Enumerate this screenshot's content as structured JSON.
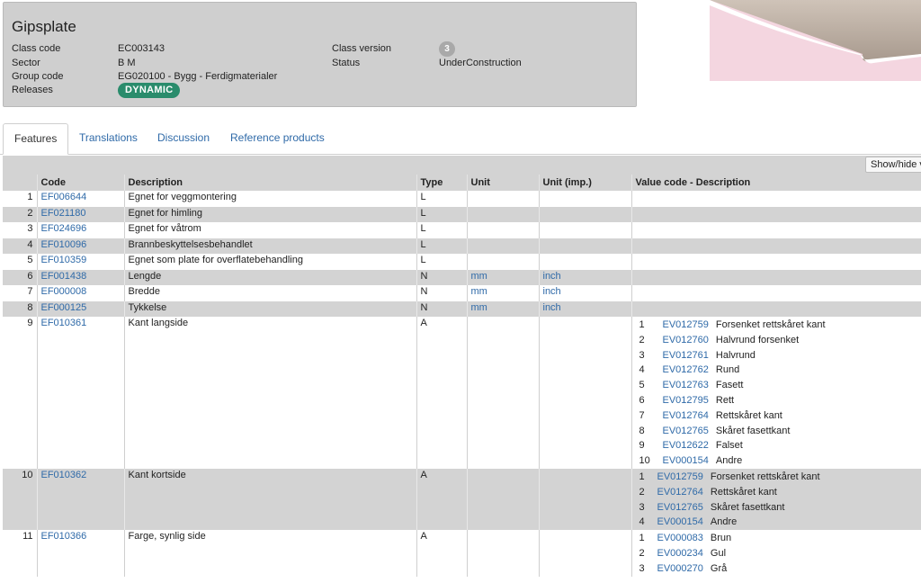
{
  "header": {
    "title": "Gipsplate",
    "fields": {
      "class_code_label": "Class code",
      "class_code": "EC003143",
      "sector_label": "Sector",
      "sector": "B M",
      "group_code_label": "Group code",
      "group_code": "EG020100 - Bygg - Ferdigmaterialer",
      "releases_label": "Releases",
      "release_badge": "DYNAMIC",
      "class_version_label": "Class version",
      "class_version": "3",
      "status_label": "Status",
      "status": "UnderConstruction"
    }
  },
  "tabs": [
    "Features",
    "Translations",
    "Discussion",
    "Reference products"
  ],
  "toolbar": {
    "show_hide_label": "Show/hide v"
  },
  "table": {
    "columns": [
      "Code",
      "Description",
      "Type",
      "Unit",
      "Unit (imp.)",
      "Value code - Description"
    ],
    "rows": [
      {
        "n": "1",
        "code": "EF006644",
        "desc": "Egnet for veggmontering",
        "type": "L",
        "unit": "",
        "unit_imp": "",
        "values": []
      },
      {
        "n": "2",
        "code": "EF021180",
        "desc": "Egnet for himling",
        "type": "L",
        "unit": "",
        "unit_imp": "",
        "values": []
      },
      {
        "n": "3",
        "code": "EF024696",
        "desc": "Egnet for våtrom",
        "type": "L",
        "unit": "",
        "unit_imp": "",
        "values": []
      },
      {
        "n": "4",
        "code": "EF010096",
        "desc": "Brannbeskyttelsesbehandlet",
        "type": "L",
        "unit": "",
        "unit_imp": "",
        "values": []
      },
      {
        "n": "5",
        "code": "EF010359",
        "desc": "Egnet som plate for overflatebehandling",
        "type": "L",
        "unit": "",
        "unit_imp": "",
        "values": []
      },
      {
        "n": "6",
        "code": "EF001438",
        "desc": "Lengde",
        "type": "N",
        "unit": "mm",
        "unit_imp": "inch",
        "values": []
      },
      {
        "n": "7",
        "code": "EF000008",
        "desc": "Bredde",
        "type": "N",
        "unit": "mm",
        "unit_imp": "inch",
        "values": []
      },
      {
        "n": "8",
        "code": "EF000125",
        "desc": "Tykkelse",
        "type": "N",
        "unit": "mm",
        "unit_imp": "inch",
        "values": []
      },
      {
        "n": "9",
        "code": "EF010361",
        "desc": "Kant langside",
        "type": "A",
        "unit": "",
        "unit_imp": "",
        "values": [
          {
            "i": "1",
            "code": "EV012759",
            "desc": "Forsenket rettskåret kant"
          },
          {
            "i": "2",
            "code": "EV012760",
            "desc": "Halvrund forsenket"
          },
          {
            "i": "3",
            "code": "EV012761",
            "desc": "Halvrund"
          },
          {
            "i": "4",
            "code": "EV012762",
            "desc": "Rund"
          },
          {
            "i": "5",
            "code": "EV012763",
            "desc": "Fasett"
          },
          {
            "i": "6",
            "code": "EV012795",
            "desc": "Rett"
          },
          {
            "i": "7",
            "code": "EV012764",
            "desc": "Rettskåret kant"
          },
          {
            "i": "8",
            "code": "EV012765",
            "desc": "Skåret fasettkant"
          },
          {
            "i": "9",
            "code": "EV012622",
            "desc": "Falset"
          },
          {
            "i": "10",
            "code": "EV000154",
            "desc": "Andre"
          }
        ]
      },
      {
        "n": "10",
        "code": "EF010362",
        "desc": "Kant kortside",
        "type": "A",
        "unit": "",
        "unit_imp": "",
        "values": [
          {
            "i": "1",
            "code": "EV012759",
            "desc": "Forsenket rettskåret kant"
          },
          {
            "i": "2",
            "code": "EV012764",
            "desc": "Rettskåret kant"
          },
          {
            "i": "3",
            "code": "EV012765",
            "desc": "Skåret fasettkant"
          },
          {
            "i": "4",
            "code": "EV000154",
            "desc": "Andre"
          }
        ]
      },
      {
        "n": "11",
        "code": "EF010366",
        "desc": "Farge, synlig side",
        "type": "A",
        "unit": "",
        "unit_imp": "",
        "values": [
          {
            "i": "1",
            "code": "EV000083",
            "desc": "Brun"
          },
          {
            "i": "2",
            "code": "EV000234",
            "desc": "Gul"
          },
          {
            "i": "3",
            "code": "EV000270",
            "desc": "Grå"
          }
        ]
      }
    ]
  },
  "colors": {
    "panel_bg": "#cfcfcf",
    "link": "#2f6aa8",
    "badge_green": "#2a8c6c",
    "row_alt": "#d3d3d3"
  }
}
